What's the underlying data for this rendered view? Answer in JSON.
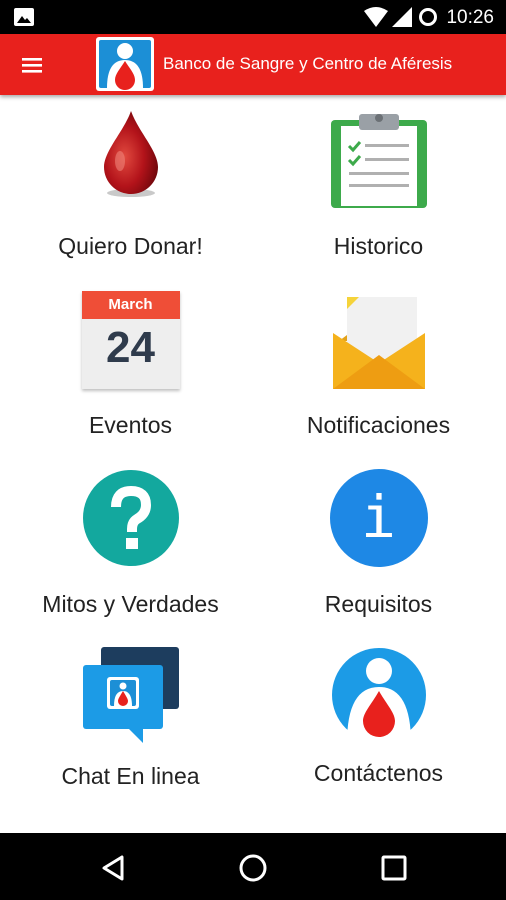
{
  "status_bar": {
    "time": "10:26"
  },
  "app_bar": {
    "title": "Banco de Sangre y Centro de Aféresis"
  },
  "menu": [
    {
      "label": "Quiero Donar!",
      "icon": "blood-drop-icon"
    },
    {
      "label": "Historico",
      "icon": "clipboard-icon"
    },
    {
      "label": "Eventos",
      "icon": "calendar-icon",
      "calendar_month": "March",
      "calendar_day": "24"
    },
    {
      "label": "Notificaciones",
      "icon": "envelope-icon"
    },
    {
      "label": "Mitos y Verdades",
      "icon": "question-icon"
    },
    {
      "label": "Requisitos",
      "icon": "info-icon",
      "glyph": "i"
    },
    {
      "label": "Chat En linea",
      "icon": "chat-icon"
    },
    {
      "label": "Contáctenos",
      "icon": "contact-logo-icon"
    }
  ],
  "colors": {
    "brand_red": "#e8211d",
    "teal": "#13a89e",
    "blue": "#1e88e5",
    "green": "#3daa4b"
  }
}
